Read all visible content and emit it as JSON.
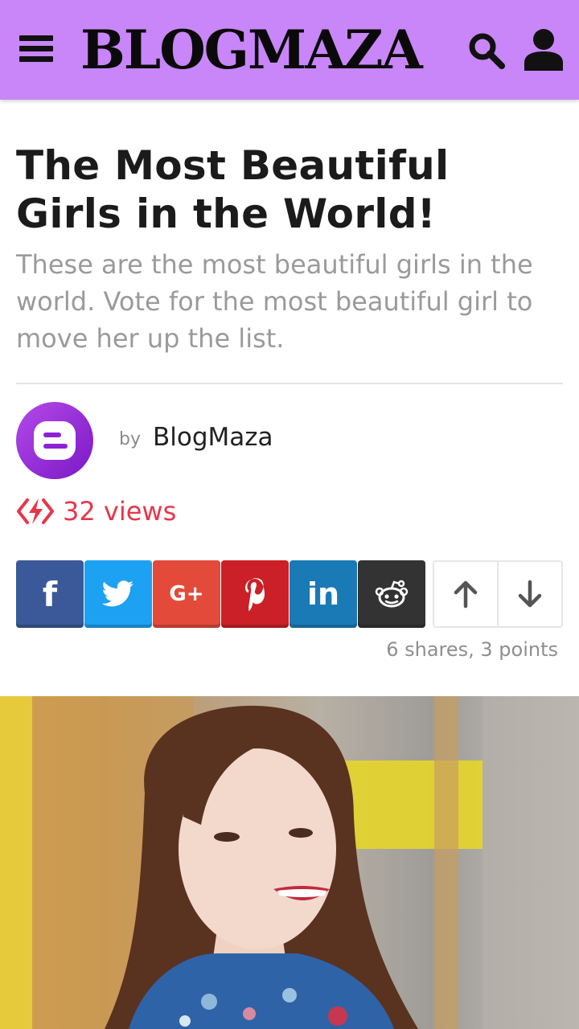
{
  "header": {
    "brand": "BLOGMAZA",
    "background_color": "#c886f8",
    "icons": [
      "menu-icon",
      "search-icon",
      "user-icon"
    ]
  },
  "article": {
    "title": "The Most Beautiful Girls in the World!",
    "subtitle": "These are the most beautiful girls in the world. Vote for the most beautiful girl to move her up the list.",
    "author_prefix": "by",
    "author": "BlogMaza",
    "views": "32 views",
    "accent_color": "#e8354a"
  },
  "share": {
    "buttons": [
      {
        "name": "facebook",
        "label": "f",
        "color": "#3b5998"
      },
      {
        "name": "twitter",
        "label": "twitter-bird",
        "color": "#1da1f2"
      },
      {
        "name": "google-plus",
        "label": "G+",
        "color": "#e44a3a"
      },
      {
        "name": "pinterest",
        "label": "P",
        "color": "#cb2027"
      },
      {
        "name": "linkedin",
        "label": "in",
        "color": "#1a7ab5"
      },
      {
        "name": "reddit",
        "label": "reddit-alien",
        "color": "#333333"
      }
    ],
    "vote_up_icon": "arrow-up-icon",
    "vote_down_icon": "arrow-down-icon",
    "stats": "6 shares, 3 points"
  },
  "hero_image": {
    "alt": "portrait photo of smiling young woman with long brown hair in floral blue dress"
  }
}
